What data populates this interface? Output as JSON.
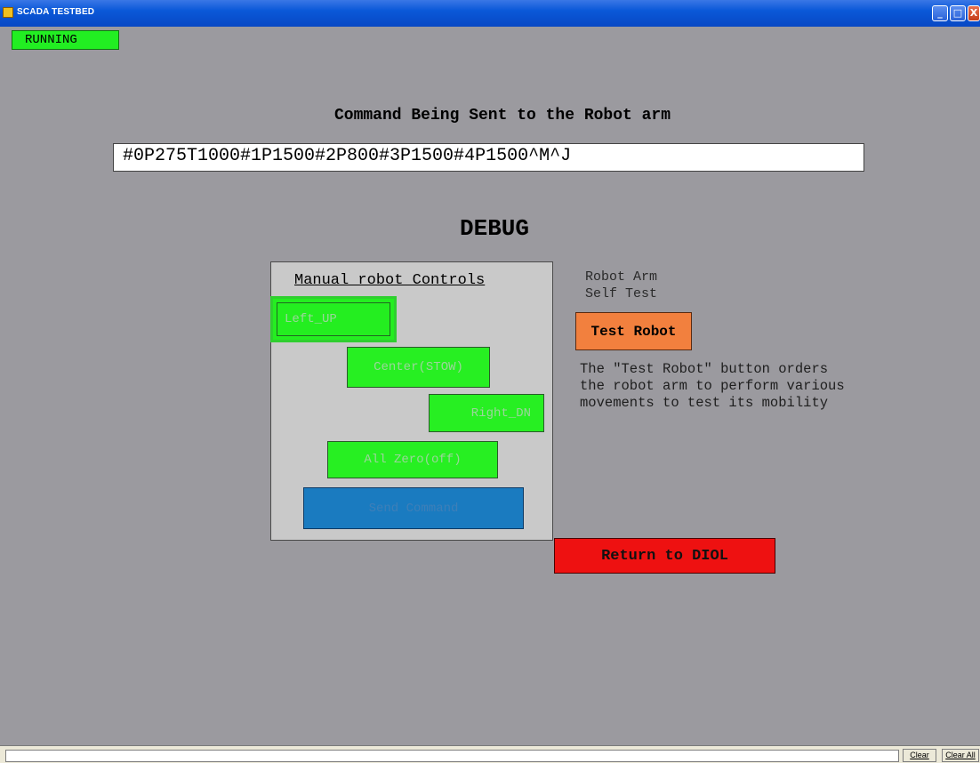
{
  "window": {
    "title": "SCADA TESTBED",
    "controls": {
      "minimize": "_",
      "maximize": "□",
      "close": "X"
    }
  },
  "status": {
    "running_label": "RUNNING"
  },
  "command": {
    "heading": "Command Being Sent to the Robot arm",
    "value": "#0P275T1000#1P1500#2P800#3P1500#4P1500^M^J"
  },
  "debug": {
    "title": "DEBUG"
  },
  "manual": {
    "title": "Manual robot Controls",
    "buttons": {
      "left_up": "Left_UP",
      "center": "Center(STOW)",
      "right_dn": "Right_DN",
      "all_zero": "All Zero(off)",
      "send": "Send Command"
    }
  },
  "selftest": {
    "label": "Robot Arm\nSelf Test",
    "button": "Test Robot",
    "description": "The \"Test Robot\" button orders\nthe robot arm to perform various\nmovements to test its mobility"
  },
  "navigation": {
    "return_label": "Return to DIOL"
  },
  "statusbar": {
    "clear_label": "Clear",
    "clear_all_label": "Clear All"
  },
  "colors": {
    "background": "#9b9a9f",
    "green_button": "#27ef22",
    "test_button": "#f2803e",
    "return_button": "#ee1111",
    "send_button": "#1a7bc0"
  }
}
